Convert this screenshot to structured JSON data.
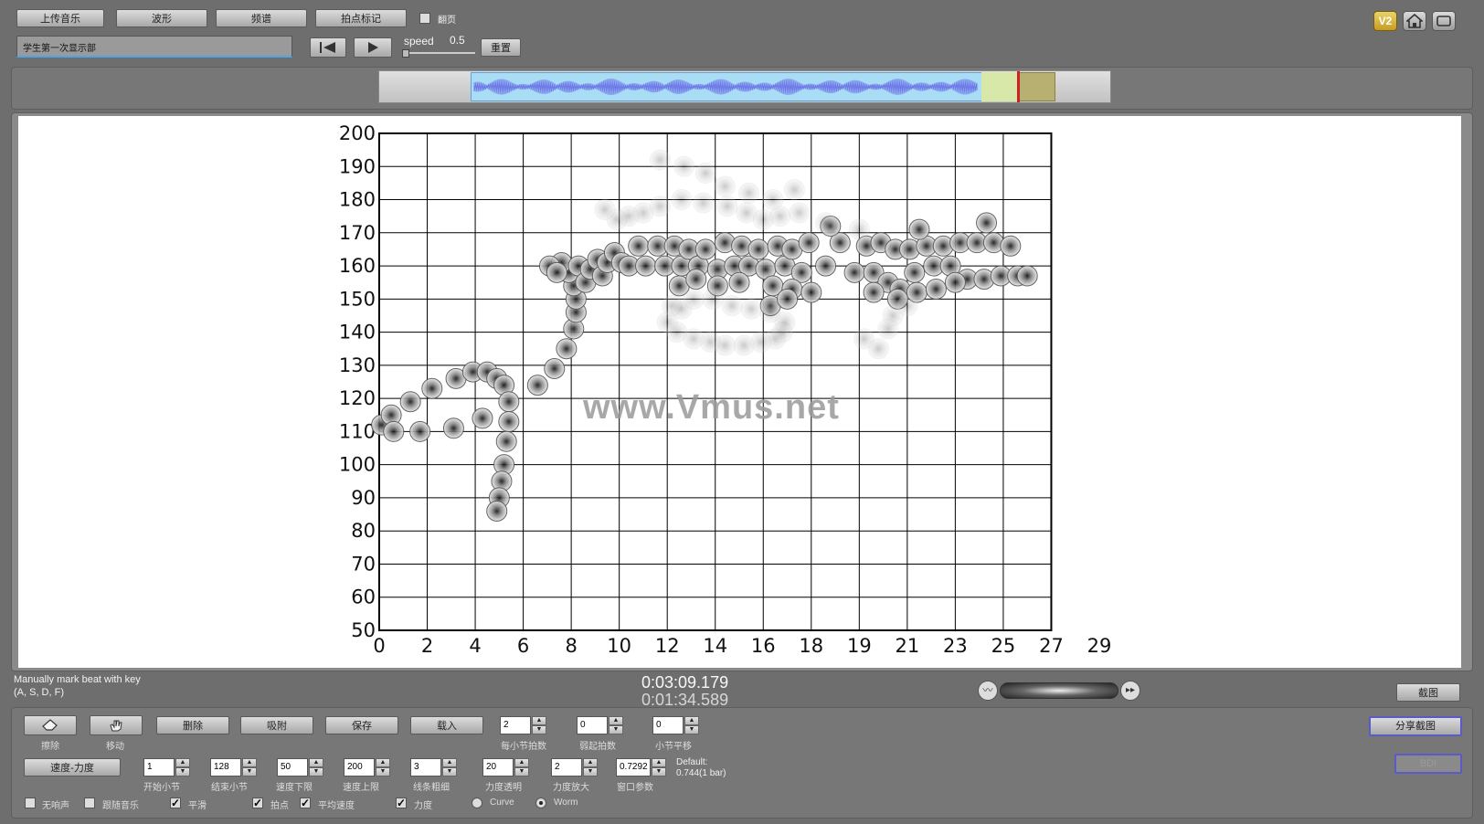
{
  "toolbar": {
    "upload_label": "上传音乐",
    "waveform_label": "波形",
    "spectrum_label": "频谱",
    "beat_mark_label": "拍点标记",
    "flip_label": "翻页",
    "title_value": "学生第一次显示部",
    "speed_label": "speed",
    "speed_value": "0.5",
    "reset_label": "重置",
    "v2_label": "V2"
  },
  "status": {
    "hint_line1": "Manually mark beat with key",
    "hint_line2": "(A, S, D, F)",
    "time_primary": "0:03:09.179",
    "time_secondary": "0:01:34.589",
    "screenshot_label": "截图"
  },
  "controls": {
    "erase_label": "擦除",
    "move_label": "移动",
    "delete_label": "删除",
    "snap_label": "吸附",
    "save_label": "保存",
    "load_label": "载入",
    "tempo_dynamics_label": "速度-力度",
    "share_label": "分享截图",
    "disabled_label": "BDI",
    "steppers_row1": [
      {
        "value": "2",
        "label": "每小节拍数"
      },
      {
        "value": "0",
        "label": "弱起拍数"
      },
      {
        "value": "0",
        "label": "小节平移"
      }
    ],
    "steppers_row2": [
      {
        "value": "1",
        "label": "开始小节"
      },
      {
        "value": "128",
        "label": "结束小节"
      },
      {
        "value": "50",
        "label": "速度下限"
      },
      {
        "value": "200",
        "label": "速度上限"
      },
      {
        "value": "3",
        "label": "线条粗细"
      },
      {
        "value": "20",
        "label": "力度透明"
      },
      {
        "value": "2",
        "label": "力度放大"
      },
      {
        "value": "0.7292",
        "label": "窗口参数"
      }
    ],
    "default_line1": "Default:",
    "default_line2": "0.744(1 bar)",
    "checkboxes": [
      {
        "label": "无响声",
        "checked": false
      },
      {
        "label": "跟随音乐",
        "checked": false
      },
      {
        "label": "平滑",
        "checked": true
      },
      {
        "label": "拍点",
        "checked": true
      },
      {
        "label": "平均速度",
        "checked": true
      },
      {
        "label": "力度",
        "checked": true
      }
    ],
    "radios": [
      {
        "label": "Curve",
        "selected": false
      },
      {
        "label": "Worm",
        "selected": true
      }
    ]
  },
  "watermark": "www.Vmus.net",
  "colors": {
    "background": "#6e6e6e",
    "waveform": "#6f79e8",
    "selection": "#a9dcf5",
    "playhead": "#cc2222",
    "highlight_box": "#b8b070"
  },
  "chart_data": {
    "type": "scatter",
    "title": "",
    "xlabel": "",
    "ylabel": "",
    "xlim": [
      0,
      29
    ],
    "ylim": [
      50,
      200
    ],
    "xticks": [
      0,
      2,
      4,
      6,
      8,
      10,
      12,
      14,
      16,
      18,
      19,
      21,
      23,
      25,
      27,
      29
    ],
    "yticks": [
      50,
      60,
      70,
      80,
      90,
      100,
      110,
      120,
      130,
      140,
      150,
      160,
      170,
      180,
      190,
      200
    ],
    "grid": true,
    "series": [
      {
        "values": [
          [
            0.1,
            112
          ],
          [
            0.5,
            115
          ],
          [
            0.6,
            110
          ],
          [
            1.3,
            119
          ],
          [
            1.7,
            110
          ],
          [
            2.2,
            123
          ],
          [
            3.1,
            111
          ],
          [
            3.2,
            126
          ],
          [
            3.9,
            128
          ],
          [
            4.3,
            114
          ],
          [
            4.5,
            128
          ],
          [
            4.9,
            126
          ],
          [
            5.2,
            124
          ],
          [
            5.4,
            119
          ],
          [
            5.4,
            113
          ],
          [
            5.3,
            107
          ],
          [
            5.2,
            100
          ],
          [
            5.1,
            95
          ],
          [
            5.0,
            90
          ],
          [
            4.9,
            86
          ],
          [
            6.6,
            124
          ],
          [
            7.3,
            129
          ],
          [
            7.8,
            135
          ],
          [
            8.1,
            141
          ],
          [
            8.2,
            146
          ],
          [
            8.2,
            150
          ],
          [
            8.1,
            154
          ],
          [
            7.9,
            158
          ],
          [
            7.6,
            161
          ],
          [
            7.1,
            160
          ],
          [
            7.4,
            158
          ],
          [
            8.3,
            160
          ],
          [
            8.6,
            155
          ],
          [
            8.8,
            159
          ],
          [
            9.1,
            162
          ],
          [
            9.3,
            157
          ],
          [
            9.5,
            161
          ],
          [
            9.8,
            164
          ],
          [
            10.1,
            161
          ],
          [
            10.4,
            160
          ],
          [
            10.8,
            166
          ],
          [
            11.1,
            160
          ],
          [
            11.6,
            166
          ],
          [
            11.9,
            160
          ],
          [
            12.3,
            166
          ],
          [
            12.6,
            160
          ],
          [
            12.9,
            165
          ],
          [
            13.3,
            160
          ],
          [
            13.6,
            165
          ],
          [
            14.1,
            159
          ],
          [
            14.4,
            167
          ],
          [
            14.8,
            160
          ],
          [
            15.1,
            166
          ],
          [
            15.4,
            160
          ],
          [
            15.8,
            165
          ],
          [
            16.1,
            159
          ],
          [
            16.6,
            166
          ],
          [
            16.9,
            160
          ],
          [
            17.2,
            165
          ],
          [
            17.6,
            158
          ],
          [
            17.9,
            167
          ],
          [
            18.3,
            160
          ],
          [
            18.6,
            167
          ],
          [
            18.9,
            158
          ],
          [
            19.3,
            166
          ],
          [
            19.6,
            158
          ],
          [
            19.9,
            167
          ],
          [
            20.2,
            155
          ],
          [
            20.5,
            165
          ],
          [
            20.7,
            153
          ],
          [
            21.1,
            165
          ],
          [
            21.3,
            158
          ],
          [
            21.8,
            166
          ],
          [
            22.1,
            160
          ],
          [
            22.5,
            166
          ],
          [
            22.8,
            160
          ],
          [
            23.2,
            167
          ],
          [
            23.5,
            156
          ],
          [
            23.9,
            167
          ],
          [
            24.2,
            156
          ],
          [
            24.6,
            167
          ],
          [
            24.9,
            157
          ],
          [
            25.3,
            166
          ],
          [
            25.6,
            157
          ],
          [
            26.0,
            157
          ],
          [
            24.3,
            173
          ],
          [
            21.5,
            171
          ],
          [
            18.4,
            172
          ],
          [
            12.5,
            154
          ],
          [
            13.2,
            156
          ],
          [
            14.1,
            154
          ],
          [
            15.0,
            155
          ],
          [
            16.4,
            154
          ],
          [
            17.2,
            153
          ],
          [
            18.0,
            152
          ],
          [
            19.6,
            152
          ],
          [
            20.6,
            150
          ],
          [
            21.4,
            152
          ],
          [
            22.2,
            153
          ],
          [
            23.0,
            155
          ],
          [
            16.3,
            148
          ],
          [
            17.0,
            150
          ]
        ]
      },
      {
        "faded": true,
        "values": [
          [
            9.4,
            177
          ],
          [
            9.9,
            174
          ],
          [
            10.4,
            175
          ],
          [
            11.0,
            176
          ],
          [
            11.7,
            178
          ],
          [
            12.6,
            180
          ],
          [
            13.5,
            179
          ],
          [
            14.5,
            178
          ],
          [
            15.3,
            176
          ],
          [
            16.0,
            174
          ],
          [
            16.7,
            175
          ],
          [
            17.5,
            176
          ],
          [
            18.3,
            173
          ],
          [
            19.0,
            171
          ],
          [
            12.2,
            148
          ],
          [
            12.0,
            143
          ],
          [
            12.4,
            140
          ],
          [
            13.1,
            138
          ],
          [
            13.8,
            137
          ],
          [
            14.4,
            136
          ],
          [
            15.2,
            136
          ],
          [
            15.9,
            137
          ],
          [
            16.5,
            138
          ],
          [
            16.8,
            140
          ],
          [
            16.9,
            143
          ],
          [
            16.3,
            146
          ],
          [
            15.5,
            147
          ],
          [
            14.7,
            148
          ],
          [
            13.9,
            150
          ],
          [
            13.1,
            150
          ],
          [
            12.6,
            147
          ],
          [
            19.2,
            138
          ],
          [
            19.8,
            135
          ],
          [
            20.2,
            141
          ],
          [
            21.0,
            148
          ],
          [
            20.4,
            145
          ],
          [
            11.7,
            192
          ],
          [
            12.7,
            190
          ],
          [
            13.6,
            188
          ],
          [
            14.4,
            184
          ],
          [
            15.4,
            182
          ],
          [
            16.4,
            180
          ],
          [
            17.3,
            183
          ]
        ]
      }
    ]
  }
}
